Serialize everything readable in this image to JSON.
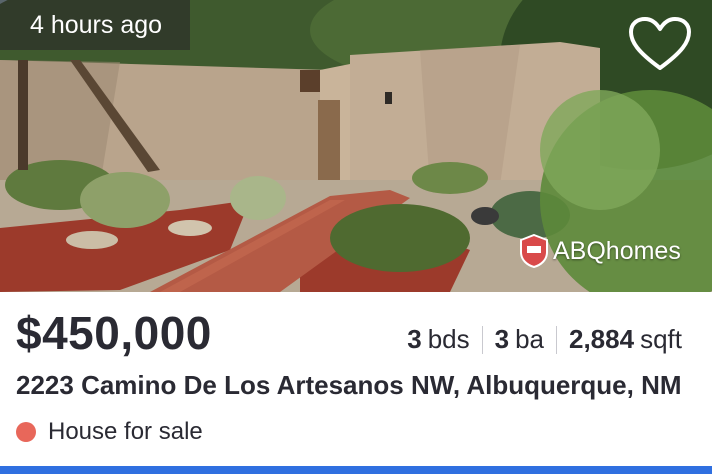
{
  "listing": {
    "posted_time": "4 hours ago",
    "price": "$450,000",
    "beds_value": "3",
    "beds_unit": "bds",
    "baths_value": "3",
    "baths_unit": "ba",
    "area_value": "2,884",
    "area_unit": "sqft",
    "address": "2223 Camino De Los Artesanos NW, Albuquerque, NM",
    "status_text": "House for sale",
    "watermark": "ABQhomes"
  },
  "icons": {
    "save": "heart-outline-icon",
    "status": "status-dot-icon",
    "watermark_logo": "realtor-seal-icon"
  },
  "colors": {
    "status_dot": "#e8675a",
    "accent_bar": "#2f6fe0",
    "text_primary": "#2a2a33"
  }
}
